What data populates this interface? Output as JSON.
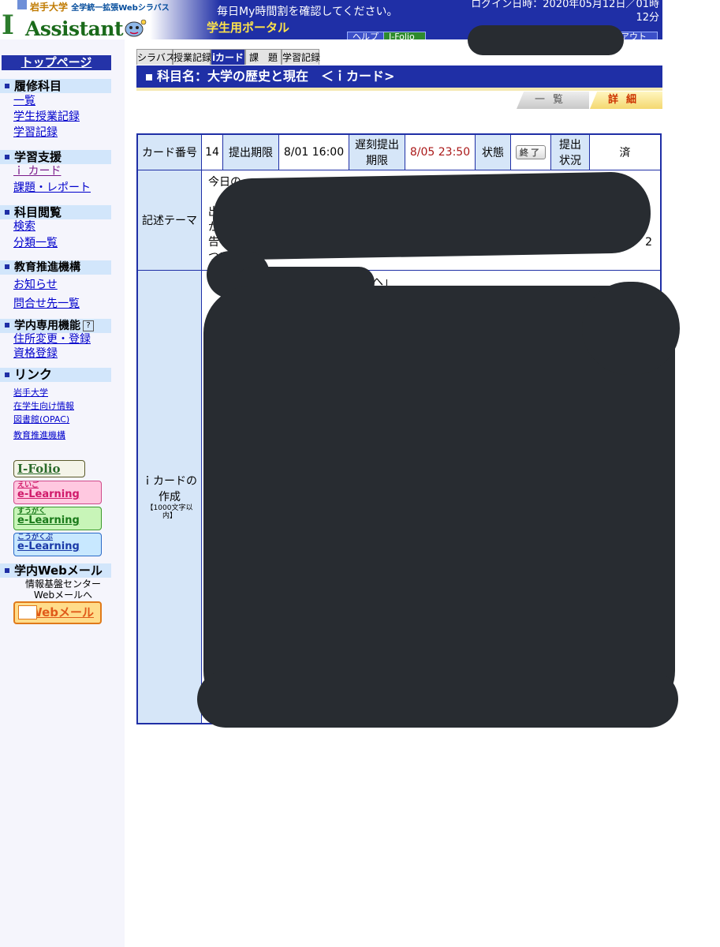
{
  "header": {
    "univ_name": "岩手大学",
    "univ_sub": "全学統一拡張Webシラバス",
    "logo_letter": "I",
    "logo_text": "Assistant",
    "notice": "毎日My時間割を確認してください。",
    "portal_label": "学生用ポータル",
    "login_line1": "ログイン日時：2020年05月12日／01時",
    "login_line2": "12分",
    "help_label": "ヘルプ",
    "folio_label": "I-Folio",
    "logout_label": "アウト"
  },
  "sidebar": {
    "top_page": "トップページ",
    "sections": [
      {
        "title": "履修科目",
        "links": [
          "一覧",
          "学生授業記録",
          "学習記録"
        ]
      },
      {
        "title": "学習支援",
        "links": [
          "ｉ カード",
          "課題・レポート"
        ]
      },
      {
        "title": "科目閲覧",
        "links": [
          "検索",
          "分類一覧"
        ]
      },
      {
        "title": "教育推進機構",
        "links": [
          "お知らせ",
          "問合せ先一覧"
        ]
      },
      {
        "title": "学内専用機能",
        "help": "?",
        "links": [
          "住所変更・登録",
          "資格登録"
        ]
      },
      {
        "title": "リンク",
        "links": [
          "岩手大学",
          "在学生向け情報",
          "図書館(OPAC)",
          "教育推進機構"
        ]
      },
      {
        "title": "学内Webメール"
      }
    ],
    "banners": {
      "folio": "I-Folio",
      "eigo_sub": "えいご",
      "eigo": "e-Learning",
      "sugaku_sub": "すうがく",
      "sugaku": "e-Learning",
      "kogaku_sub": "こうがくぶ",
      "kogaku": "e-Learning",
      "webmail": "Webメール"
    },
    "mail_note_line1": "情報基盤センター",
    "mail_note_line2": "Webメールへ"
  },
  "tabs": [
    "シラバス",
    "授業記録",
    "iカード",
    "課　題",
    "学習記録"
  ],
  "title": "科目名：大学の歴史と現在　＜ｉカード>",
  "view_buttons": {
    "list": "一覧",
    "detail": "詳細"
  },
  "card": {
    "number_label": "カード番号",
    "number": "14",
    "deadline_label": "提出期限",
    "deadline": "8/01 16:00",
    "late_label": "遅刻提出期限",
    "late_deadline": "8/05 23:50",
    "status_label": "状態",
    "status": "終了",
    "submit_label": "提出状況",
    "submit_status": "済",
    "theme_label": "記述テーマ",
    "theme_line1": "今日の",
    "theme_line2": "出",
    "theme_line3": "か",
    "theme_line4": "告",
    "theme_line5": "つい",
    "theme_tail": "2",
    "create_label": "ｉカードの作成",
    "create_note": "【1000文字以内】",
    "answer_visible": "へ」"
  },
  "colors": {
    "header_blue": "#1f2fa6",
    "section_bg": "#d2e6fb",
    "table_header_bg": "#d6e6f8",
    "late_deadline_red": "#aa1818",
    "redaction": "#282c31"
  }
}
